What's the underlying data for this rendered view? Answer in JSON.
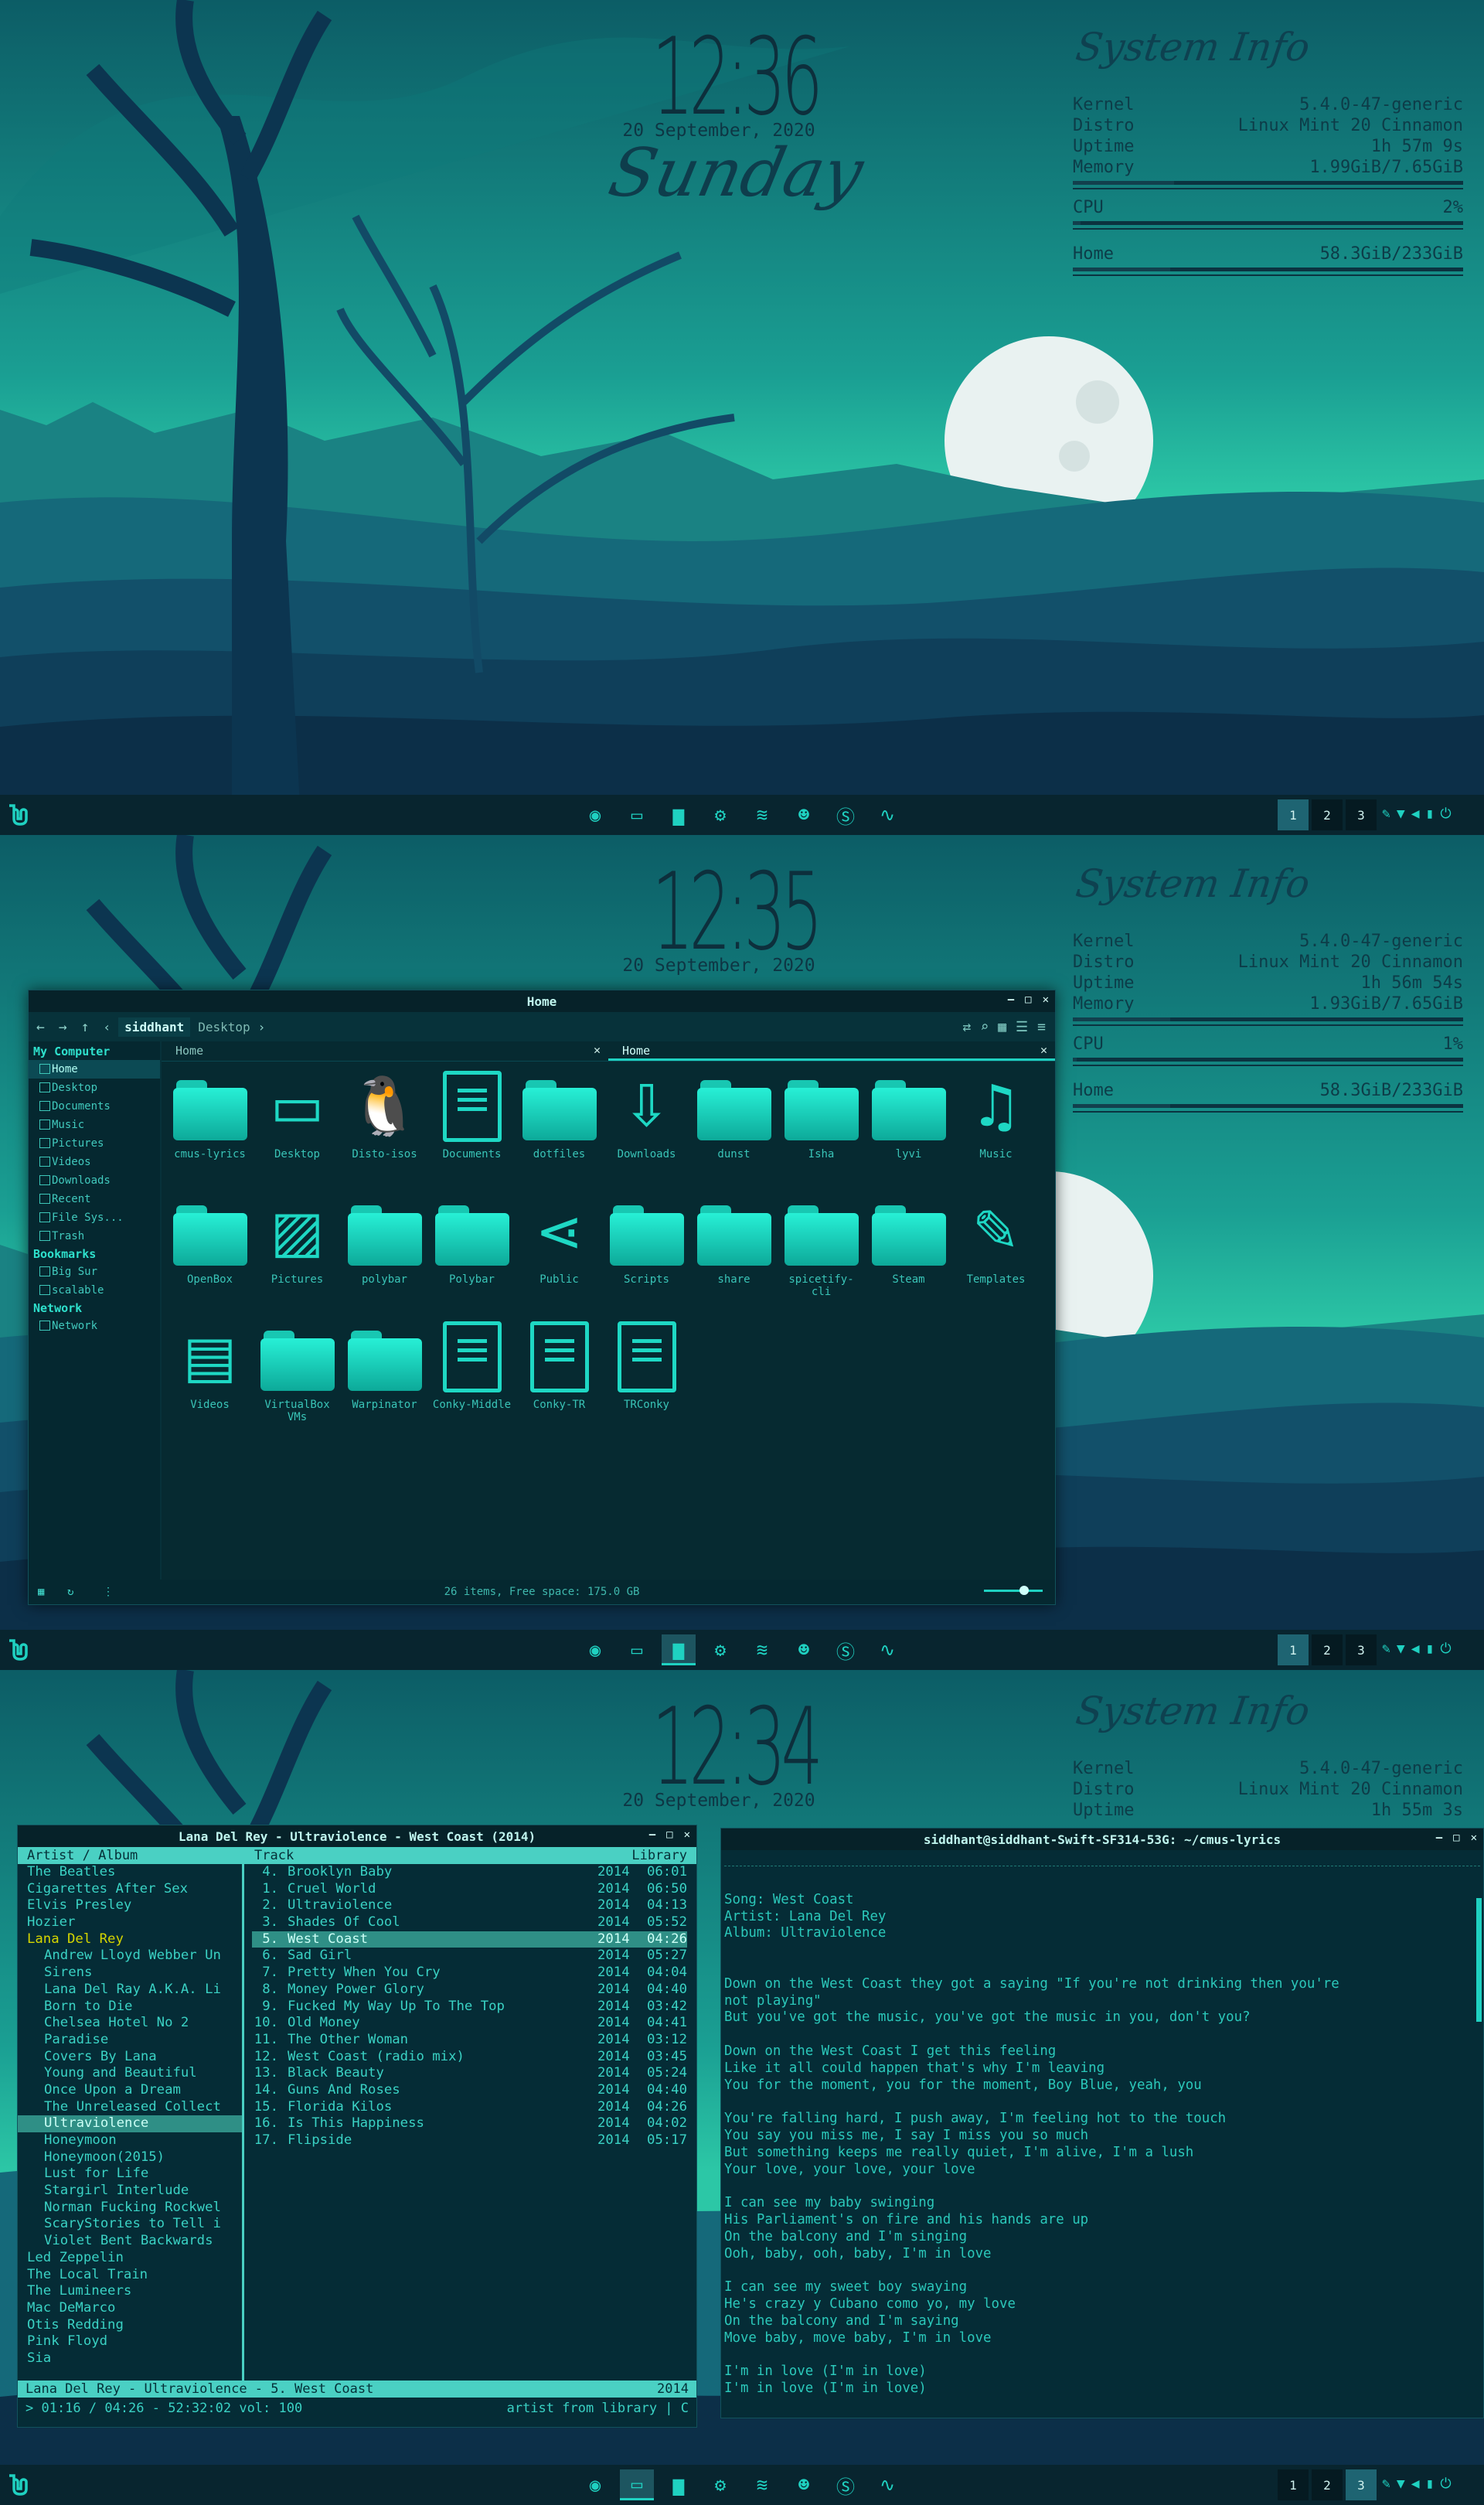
{
  "screens": [
    {
      "clock": {
        "time": "12:36",
        "date": "20 September, 2020",
        "day": "Sunday"
      },
      "sysinfo": {
        "title": "System Info",
        "kernel": "5.4.0-47-generic",
        "distro": "Linux Mint 20 Cinnamon",
        "uptime": "1h 57m 9s",
        "memory": "1.99GiB/7.65GiB",
        "cpu": "2%",
        "home": "58.3GiB/233GiB",
        "show_cpu_home": true
      }
    },
    {
      "clock": {
        "time": "12:35",
        "date": "20 September, 2020",
        "day": ""
      },
      "sysinfo": {
        "title": "System Info",
        "kernel": "5.4.0-47-generic",
        "distro": "Linux Mint 20 Cinnamon",
        "uptime": "1h 56m 54s",
        "memory": "1.93GiB/7.65GiB",
        "cpu": "1%",
        "home": "58.3GiB/233GiB"
      }
    },
    {
      "clock": {
        "time": "12:34",
        "date": "20 September, 2020",
        "day": ""
      },
      "sysinfo": {
        "title": "System Info",
        "kernel": "5.4.0-47-generic",
        "distro": "Linux Mint 20 Cinnamon",
        "uptime": "1h 55m 3s"
      }
    }
  ],
  "labels": {
    "kernel": "Kernel",
    "distro": "Distro",
    "uptime": "Uptime",
    "memory": "Memory",
    "cpu": "CPU",
    "home": "Home"
  },
  "panel": {
    "launchers": [
      "firefox-icon",
      "terminal-icon",
      "files-icon",
      "steam-icon",
      "spotify-icon",
      "discord-icon",
      "skype-icon",
      "system-monitor-icon"
    ],
    "workspaces": [
      "1",
      "2",
      "3"
    ]
  },
  "nemo": {
    "title": "Home",
    "crumb_home": "siddhant",
    "crumb_next": "Desktop",
    "sidebar": {
      "my_computer": "My Computer",
      "items": [
        "Home",
        "Desktop",
        "Documents",
        "Music",
        "Pictures",
        "Videos",
        "Downloads",
        "Recent",
        "File Sys...",
        "Trash"
      ],
      "bookmarks": "Bookmarks",
      "bookmark_items": [
        "Big Sur",
        "scalable"
      ],
      "network": "Network",
      "network_items": [
        "Network"
      ]
    },
    "tabs": [
      "Home",
      "Home"
    ],
    "items": [
      {
        "label": "cmus-lyrics",
        "kind": "folder"
      },
      {
        "label": "Desktop",
        "kind": "desktop"
      },
      {
        "label": "Disto-isos",
        "kind": "linux"
      },
      {
        "label": "Documents",
        "kind": "doc"
      },
      {
        "label": "dotfiles",
        "kind": "folder"
      },
      {
        "label": "Downloads",
        "kind": "download"
      },
      {
        "label": "dunst",
        "kind": "folder"
      },
      {
        "label": "Isha",
        "kind": "folder"
      },
      {
        "label": "lyvi",
        "kind": "folder"
      },
      {
        "label": "Music",
        "kind": "music"
      },
      {
        "label": "OpenBox",
        "kind": "folder"
      },
      {
        "label": "Pictures",
        "kind": "picture"
      },
      {
        "label": "polybar",
        "kind": "folder"
      },
      {
        "label": "Polybar",
        "kind": "folder"
      },
      {
        "label": "Public",
        "kind": "share"
      },
      {
        "label": "Scripts",
        "kind": "folder"
      },
      {
        "label": "share",
        "kind": "folder"
      },
      {
        "label": "spicetify-cli",
        "kind": "folder"
      },
      {
        "label": "Steam",
        "kind": "folder"
      },
      {
        "label": "Templates",
        "kind": "templates"
      },
      {
        "label": "Videos",
        "kind": "video"
      },
      {
        "label": "VirtualBox VMs",
        "kind": "folder"
      },
      {
        "label": "Warpinator",
        "kind": "folder"
      },
      {
        "label": "Conky-Middle",
        "kind": "doc"
      },
      {
        "label": "Conky-TR",
        "kind": "doc"
      },
      {
        "label": "TRConky",
        "kind": "doc"
      }
    ],
    "status": "26 items, Free space: 175.0 GB"
  },
  "cmus": {
    "title": "Lana Del Rey - Ultraviolence - West Coast (2014)",
    "header_left": "Artist / Album",
    "header_track": "Track",
    "header_library": "Library",
    "artists": [
      {
        "name": "The Beatles",
        "indent": false
      },
      {
        "name": "Cigarettes After Sex",
        "indent": false
      },
      {
        "name": "Elvis Presley",
        "indent": false
      },
      {
        "name": "Hozier",
        "indent": false
      },
      {
        "name": "Lana Del Rey",
        "indent": false,
        "current": true
      },
      {
        "name": "Andrew Lloyd Webber Un",
        "indent": true
      },
      {
        "name": "Sirens",
        "indent": true
      },
      {
        "name": "Lana Del Ray A.K.A. Li",
        "indent": true
      },
      {
        "name": "Born to Die",
        "indent": true
      },
      {
        "name": "Chelsea Hotel No 2",
        "indent": true
      },
      {
        "name": "Paradise",
        "indent": true
      },
      {
        "name": "Covers By Lana",
        "indent": true
      },
      {
        "name": "Young and Beautiful",
        "indent": true
      },
      {
        "name": "Once Upon a Dream",
        "indent": true
      },
      {
        "name": "The Unreleased Collect",
        "indent": true
      },
      {
        "name": "Ultraviolence",
        "indent": true,
        "selected": true
      },
      {
        "name": "Honeymoon",
        "indent": true
      },
      {
        "name": "Honeymoon(2015)",
        "indent": true
      },
      {
        "name": "Lust for Life",
        "indent": true
      },
      {
        "name": "Stargirl Interlude",
        "indent": true
      },
      {
        "name": "Norman Fucking Rockwel",
        "indent": true
      },
      {
        "name": "ScaryStories to Tell i",
        "indent": true
      },
      {
        "name": "Violet Bent Backwards",
        "indent": true
      },
      {
        "name": "Led Zeppelin",
        "indent": false
      },
      {
        "name": "The Local Train",
        "indent": false
      },
      {
        "name": "The Lumineers",
        "indent": false
      },
      {
        "name": "Mac DeMarco",
        "indent": false
      },
      {
        "name": "Otis Redding",
        "indent": false
      },
      {
        "name": "Pink Floyd",
        "indent": false
      },
      {
        "name": "Sia",
        "indent": false
      }
    ],
    "tracks": [
      {
        "n": "4.",
        "t": "Brooklyn Baby",
        "y": "2014",
        "d": "06:01"
      },
      {
        "n": "1.",
        "t": "Cruel World",
        "y": "2014",
        "d": "06:50"
      },
      {
        "n": "2.",
        "t": "Ultraviolence",
        "y": "2014",
        "d": "04:13"
      },
      {
        "n": "3.",
        "t": "Shades Of Cool",
        "y": "2014",
        "d": "05:52"
      },
      {
        "n": "5.",
        "t": "West Coast",
        "y": "2014",
        "d": "04:26",
        "selected": true
      },
      {
        "n": "6.",
        "t": "Sad Girl",
        "y": "2014",
        "d": "05:27"
      },
      {
        "n": "7.",
        "t": "Pretty When You Cry",
        "y": "2014",
        "d": "04:04"
      },
      {
        "n": "8.",
        "t": "Money Power Glory",
        "y": "2014",
        "d": "04:40"
      },
      {
        "n": "9.",
        "t": "Fucked My Way Up To The Top",
        "y": "2014",
        "d": "03:42"
      },
      {
        "n": "10.",
        "t": "Old Money",
        "y": "2014",
        "d": "04:41"
      },
      {
        "n": "11.",
        "t": "The Other Woman",
        "y": "2014",
        "d": "03:12"
      },
      {
        "n": "12.",
        "t": "West Coast (radio mix)",
        "y": "2014",
        "d": "03:45"
      },
      {
        "n": "13.",
        "t": "Black Beauty",
        "y": "2014",
        "d": "05:24"
      },
      {
        "n": "14.",
        "t": "Guns And Roses",
        "y": "2014",
        "d": "04:40"
      },
      {
        "n": "15.",
        "t": "Florida Kilos",
        "y": "2014",
        "d": "04:26"
      },
      {
        "n": "16.",
        "t": "Is This Happiness",
        "y": "2014",
        "d": "04:02"
      },
      {
        "n": "17.",
        "t": "Flipside",
        "y": "2014",
        "d": "05:17"
      }
    ],
    "status_left": "Lana Del Rey - Ultraviolence -  5. West Coast",
    "status_right": "2014",
    "bottom_left": "> 01:16 / 04:26 - 52:32:02 vol: 100",
    "bottom_right": "artist from library | C"
  },
  "terminal": {
    "title": "siddhant@siddhant-Swift-SF314-53G: ~/cmus-lyrics",
    "lines": [
      "",
      "Song: West Coast",
      "Artist: Lana Del Rey",
      "Album: Ultraviolence",
      "",
      "",
      "Down on the West Coast they got a saying \"If you're not drinking then you're",
      "not playing\"",
      "But you've got the music, you've got the music in you, don't you?",
      "",
      "Down on the West Coast I get this feeling",
      "Like it all could happen that's why I'm leaving",
      "You for the moment, you for the moment, Boy Blue, yeah, you",
      "",
      "You're falling hard, I push away, I'm feeling hot to the touch",
      "You say you miss me, I say I miss you so much",
      "But something keeps me really quiet, I'm alive, I'm a lush",
      "Your love, your love, your love",
      "",
      "I can see my baby swinging",
      "His Parliament's on fire and his hands are up",
      "On the balcony and I'm singing",
      "Ooh, baby, ooh, baby, I'm in love",
      "",
      "I can see my sweet boy swaying",
      "He's crazy y Cubano como yo, my love",
      "On the balcony and I'm saying",
      "Move baby, move baby, I'm in love",
      "",
      "I'm in love (I'm in love)",
      "I'm in love (I'm in love)"
    ]
  },
  "colors": {
    "accent": "#1fd1c1",
    "panel": "#08252f",
    "sky_top": "#0c5d66",
    "sky_glow": "#29c7a5"
  }
}
